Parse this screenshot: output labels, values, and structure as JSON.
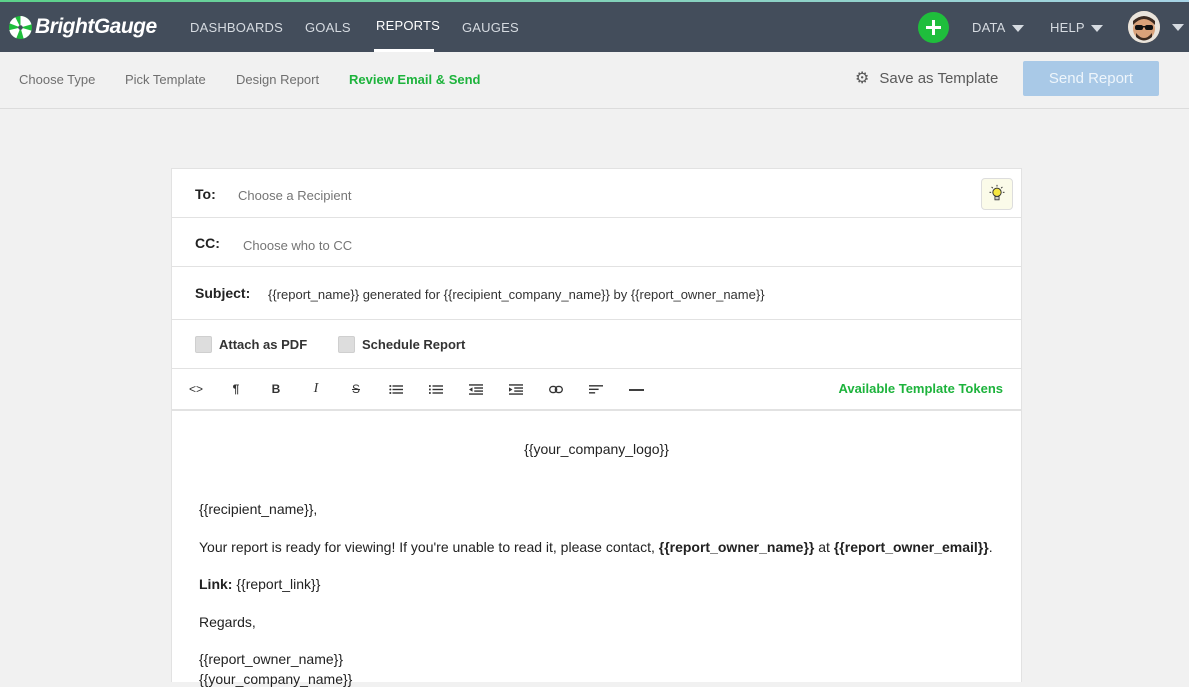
{
  "app": {
    "name": "BrightGauge"
  },
  "nav": {
    "dashboards": "DASHBOARDS",
    "goals": "GOALS",
    "reports": "REPORTS",
    "gauges": "GAUGES",
    "data": "DATA",
    "help": "HELP"
  },
  "steps": {
    "choose_type": "Choose Type",
    "pick_template": "Pick Template",
    "design_report": "Design Report",
    "review_email": "Review Email & Send"
  },
  "actions": {
    "save_template": "Save as Template",
    "send_report": "Send Report"
  },
  "email": {
    "to_label": "To:",
    "to_placeholder": "Choose a Recipient",
    "cc_label": "CC:",
    "cc_placeholder": "Choose who to CC",
    "subject_label": "Subject:",
    "subject_value": "{{report_name}} generated for {{recipient_company_name}} by {{report_owner_name}}",
    "attach_pdf": "Attach as PDF",
    "schedule_report": "Schedule Report"
  },
  "toolbar": {
    "code": "<>",
    "paragraph": "¶",
    "bold": "B",
    "italic": "I",
    "strike": "S",
    "tokens_link": "Available Template Tokens"
  },
  "body": {
    "logo_token": "{{your_company_logo}}",
    "greeting": "{{recipient_name}},",
    "message_prefix": "Your report is ready for viewing! If you're unable to read it, please contact, ",
    "owner_token": "{{report_owner_name}}",
    "message_mid": " at ",
    "owner_email_token": "{{report_owner_email}}",
    "message_end": ".",
    "link_label": "Link:",
    "link_token": " {{report_link}}",
    "regards": "Regards,",
    "sign_name": "{{report_owner_name}}",
    "sign_company": "{{your_company_name}}"
  },
  "colors": {
    "accent": "#1db33c",
    "navbar": "#434d5b",
    "send_disabled": "#a9c9e7"
  }
}
